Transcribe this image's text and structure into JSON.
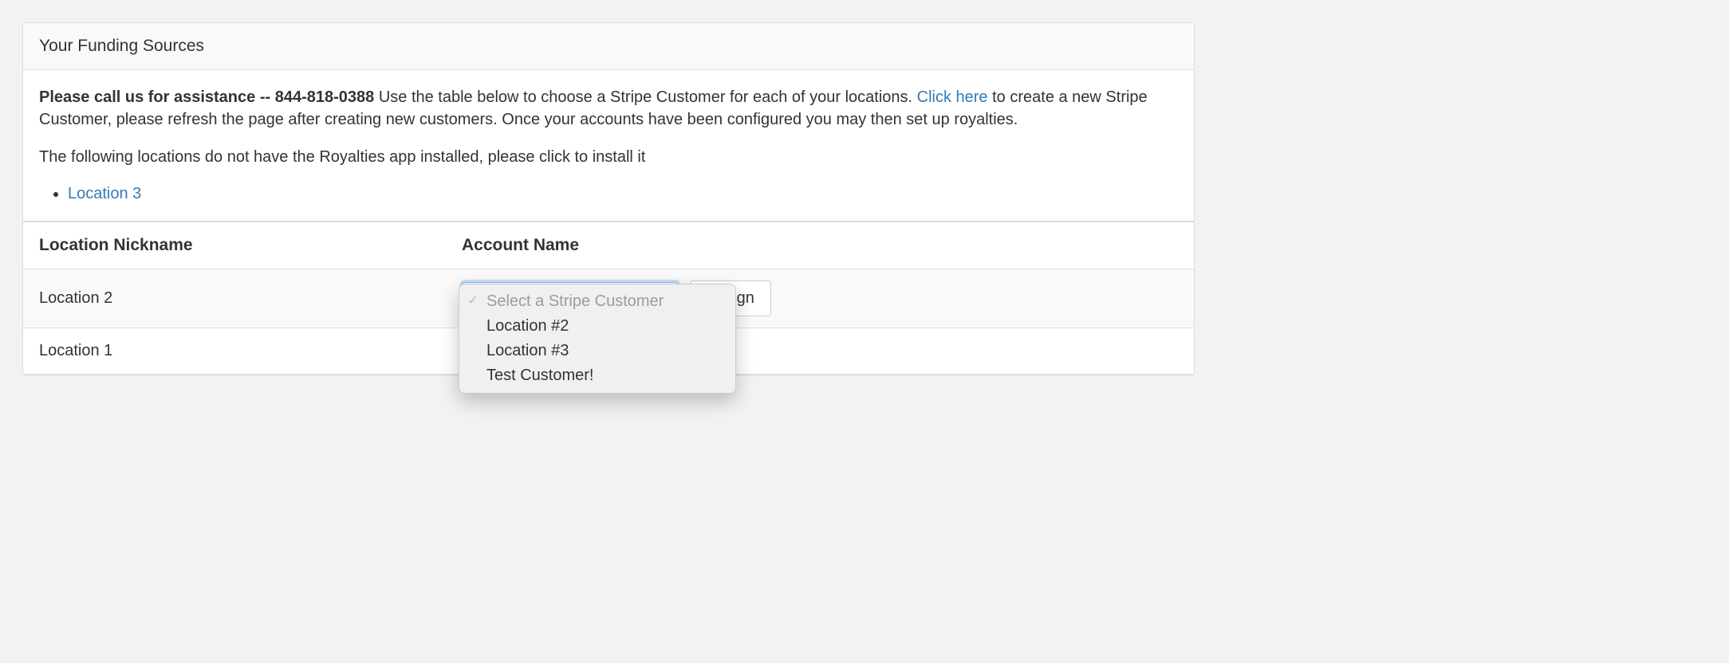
{
  "panel": {
    "title": "Your Funding Sources"
  },
  "intro": {
    "bold": "Please call us for assistance -- 844-818-0388",
    "before_link": " Use the table below to choose a Stripe Customer for each of your locations. ",
    "link_text": "Click here",
    "after_link": " to create a new Stripe Customer, please refresh the page after creating new customers. Once your accounts have been configured you may then set up royalties."
  },
  "missing": {
    "text": "The following locations do not have the Royalties app installed, please click to install it",
    "items": [
      {
        "label": "Location 3"
      }
    ]
  },
  "table": {
    "headers": {
      "nickname": "Location Nickname",
      "account": "Account Name"
    },
    "rows": [
      {
        "nickname": "Location 2",
        "has_select": true
      },
      {
        "nickname": "Location 1",
        "has_select": false
      }
    ]
  },
  "select": {
    "placeholder": "Select a Stripe Customer",
    "options": [
      "Location #2",
      "Location #3",
      "Test Customer!"
    ]
  },
  "buttons": {
    "assign": "Assign"
  }
}
